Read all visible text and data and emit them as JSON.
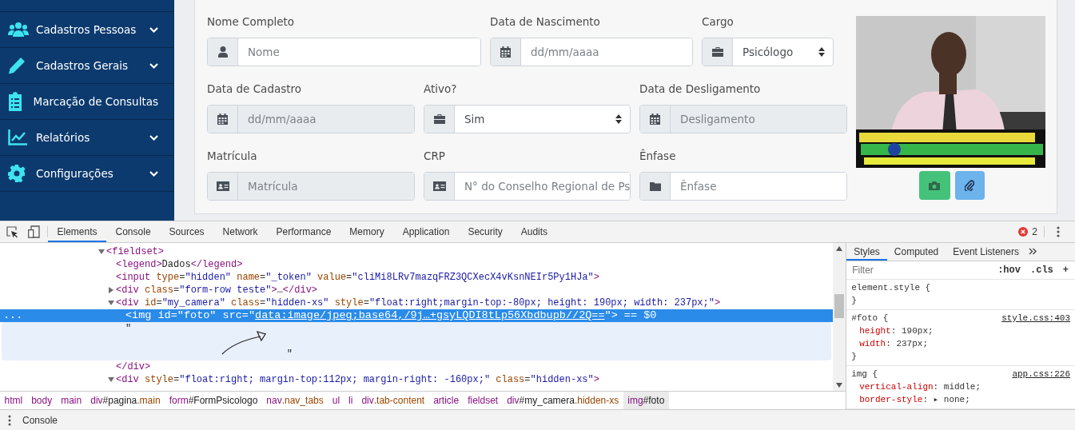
{
  "sidebar": {
    "items": [
      {
        "label": "Cadastros Pessoas",
        "expandable": true
      },
      {
        "label": "Cadastros Gerais",
        "expandable": true
      },
      {
        "label": "Marcação de Consultas",
        "expandable": false
      },
      {
        "label": "Relatórios",
        "expandable": true
      },
      {
        "label": "Configurações",
        "expandable": true
      }
    ]
  },
  "form": {
    "rows": [
      [
        {
          "label": "Nome Completo",
          "kind": "text",
          "placeholder": "Nome",
          "disabled": false
        },
        {
          "label": "Data de Nascimento",
          "kind": "text",
          "placeholder": "dd/mm/aaaa",
          "disabled": false
        },
        {
          "label": "Cargo",
          "kind": "select",
          "value": "Psicólogo",
          "disabled": false
        }
      ],
      [
        {
          "label": "Data de Cadastro",
          "kind": "text",
          "placeholder": "dd/mm/aaaa",
          "disabled": true
        },
        {
          "label": "Ativo?",
          "kind": "select",
          "value": "Sim",
          "disabled": false
        },
        {
          "label": "Data de Desligamento",
          "kind": "text",
          "placeholder": "Desligamento",
          "disabled": true
        }
      ],
      [
        {
          "label": "Matrícula",
          "kind": "text",
          "placeholder": "Matrícula",
          "disabled": true
        },
        {
          "label": "CRP",
          "kind": "text",
          "placeholder": "N° do Conselho Regional de Ps",
          "disabled": false
        },
        {
          "label": "Ênfase",
          "kind": "text",
          "placeholder": "Ênfase",
          "disabled": false
        }
      ]
    ]
  },
  "devtools": {
    "tabs": [
      {
        "label": "Elements",
        "selected": true
      },
      {
        "label": "Console",
        "selected": false
      },
      {
        "label": "Sources",
        "selected": false
      },
      {
        "label": "Network",
        "selected": false
      },
      {
        "label": "Performance",
        "selected": false
      },
      {
        "label": "Memory",
        "selected": false
      },
      {
        "label": "Application",
        "selected": false
      },
      {
        "label": "Security",
        "selected": false
      },
      {
        "label": "Audits",
        "selected": false
      }
    ],
    "error_count": "2",
    "dom_tree": [
      {
        "expanded": true,
        "selected": false,
        "tokens": [
          {
            "kind": "tag",
            "text": "<fieldset>"
          }
        ],
        "children": [
          {
            "selected": false,
            "tokens": [
              {
                "kind": "tag",
                "text": "<legend>"
              },
              {
                "kind": "text",
                "text": "Dados"
              },
              {
                "kind": "tag",
                "text": "</legend>"
              }
            ]
          },
          {
            "selected": false,
            "tokens": [
              {
                "kind": "tag",
                "text": "<input"
              },
              {
                "kind": "attr",
                "text": " type"
              },
              {
                "kind": "punct",
                "text": "="
              },
              {
                "kind": "value",
                "text": "\"hidden\""
              },
              {
                "kind": "attr",
                "text": " name"
              },
              {
                "kind": "punct",
                "text": "="
              },
              {
                "kind": "value",
                "text": "\"_token\""
              },
              {
                "kind": "attr",
                "text": " value"
              },
              {
                "kind": "punct",
                "text": "="
              },
              {
                "kind": "value",
                "text": "\"cliMi8LRv7mazqFRZ3QCXecX4vKsnNEIr5Py1HJa\""
              },
              {
                "kind": "tag",
                "text": ">"
              }
            ]
          },
          {
            "expanded": false,
            "selected": false,
            "tokens": [
              {
                "kind": "tag",
                "text": "<div"
              },
              {
                "kind": "attr",
                "text": " class"
              },
              {
                "kind": "punct",
                "text": "="
              },
              {
                "kind": "value",
                "text": "\"form-row teste\""
              },
              {
                "kind": "tag",
                "text": ">"
              },
              {
                "kind": "text",
                "text": "…"
              },
              {
                "kind": "tag",
                "text": "</div>"
              }
            ]
          },
          {
            "expanded": true,
            "selected": false,
            "tokens": [
              {
                "kind": "tag",
                "text": "<div"
              },
              {
                "kind": "attr",
                "text": " id"
              },
              {
                "kind": "punct",
                "text": "="
              },
              {
                "kind": "value",
                "text": "\"my_camera\""
              },
              {
                "kind": "attr",
                "text": " class"
              },
              {
                "kind": "punct",
                "text": "="
              },
              {
                "kind": "value",
                "text": "\"hidden-xs\""
              },
              {
                "kind": "attr",
                "text": " style"
              },
              {
                "kind": "punct",
                "text": "="
              },
              {
                "kind": "value",
                "text": "\"float:right;margin-top:-80px; height: 190px; width: 237px;\""
              },
              {
                "kind": "tag",
                "text": ">"
              }
            ],
            "children": [
              {
                "selected": true,
                "gutter": "...",
                "tokens": [
                  {
                    "kind": "tag",
                    "text": "<img"
                  },
                  {
                    "kind": "attr",
                    "text": " id"
                  },
                  {
                    "kind": "punct",
                    "text": "="
                  },
                  {
                    "kind": "value",
                    "text": "\"foto\""
                  },
                  {
                    "kind": "attr",
                    "text": " src"
                  },
                  {
                    "kind": "punct",
                    "text": "="
                  },
                  {
                    "kind": "value",
                    "text": "\""
                  },
                  {
                    "kind": "link",
                    "text": "data:image/jpeg;base64,/9j…+gsyLQDI8tLp56Xbdbupb//2Q=="
                  },
                  {
                    "kind": "value",
                    "text": "\""
                  },
                  {
                    "kind": "tag",
                    "text": ">"
                  },
                  {
                    "kind": "hint",
                    "text": " == $0"
                  }
                ]
              },
              {
                "selected": false,
                "hovered": true,
                "text_node": "\"\n\n                            \""
              }
            ],
            "closing": [
              {
                "kind": "tag",
                "text": "</div>"
              }
            ]
          },
          {
            "expanded": true,
            "selected": false,
            "tokens": [
              {
                "kind": "tag",
                "text": "<div"
              },
              {
                "kind": "attr",
                "text": " style"
              },
              {
                "kind": "punct",
                "text": "="
              },
              {
                "kind": "value",
                "text": "\"float:right; margin-top:112px; margin-right: -160px;\""
              },
              {
                "kind": "attr",
                "text": " class"
              },
              {
                "kind": "punct",
                "text": "="
              },
              {
                "kind": "value",
                "text": "\"hidden-xs\""
              },
              {
                "kind": "tag",
                "text": ">"
              }
            ]
          }
        ]
      }
    ],
    "breadcrumbs": [
      {
        "selected": false,
        "tokens": [
          {
            "kind": "tag",
            "text": "html"
          }
        ]
      },
      {
        "selected": false,
        "tokens": [
          {
            "kind": "tag",
            "text": "body"
          }
        ]
      },
      {
        "selected": false,
        "tokens": [
          {
            "kind": "tag",
            "text": "main"
          }
        ]
      },
      {
        "selected": false,
        "tokens": [
          {
            "kind": "tag",
            "text": "div"
          },
          {
            "kind": "id",
            "text": "#pagina"
          },
          {
            "kind": "class",
            "text": ".main"
          }
        ]
      },
      {
        "selected": false,
        "tokens": [
          {
            "kind": "tag",
            "text": "form"
          },
          {
            "kind": "id",
            "text": "#FormPsicologo"
          }
        ]
      },
      {
        "selected": false,
        "tokens": [
          {
            "kind": "tag",
            "text": "nav"
          },
          {
            "kind": "class",
            "text": ".nav_tabs"
          }
        ]
      },
      {
        "selected": false,
        "tokens": [
          {
            "kind": "tag",
            "text": "ul"
          }
        ]
      },
      {
        "selected": false,
        "tokens": [
          {
            "kind": "tag",
            "text": "li"
          }
        ]
      },
      {
        "selected": false,
        "tokens": [
          {
            "kind": "tag",
            "text": "div"
          },
          {
            "kind": "class",
            "text": ".tab-content"
          }
        ]
      },
      {
        "selected": false,
        "tokens": [
          {
            "kind": "tag",
            "text": "article"
          }
        ]
      },
      {
        "selected": false,
        "tokens": [
          {
            "kind": "tag",
            "text": "fieldset"
          }
        ]
      },
      {
        "selected": false,
        "tokens": [
          {
            "kind": "tag",
            "text": "div"
          },
          {
            "kind": "id",
            "text": "#my_camera"
          },
          {
            "kind": "class",
            "text": ".hidden-xs"
          }
        ]
      },
      {
        "selected": true,
        "tokens": [
          {
            "kind": "tag",
            "text": "img"
          },
          {
            "kind": "id",
            "text": "#foto"
          }
        ]
      }
    ],
    "styles_pane": {
      "tabs": [
        {
          "label": "Styles",
          "selected": true
        },
        {
          "label": "Computed",
          "selected": false
        },
        {
          "label": "Event Listeners",
          "selected": false
        }
      ],
      "filter_placeholder": "Filter",
      "buttons": [
        ":hov",
        ".cls",
        "+"
      ],
      "rules": [
        {
          "selector": "element.style",
          "open_brace": " {",
          "close_brace": "}"
        },
        {
          "selector": "#foto",
          "open_brace": " {",
          "source": "style.css:403",
          "close_brace": "}",
          "declarations": [
            {
              "property": "height",
              "value": ": 190px;"
            },
            {
              "property": "width",
              "value": ": 237px;"
            }
          ]
        },
        {
          "selector": "img",
          "open_brace": " {",
          "source": "app.css:226",
          "declarations": [
            {
              "property": "vertical-align",
              "value": ": middle;"
            },
            {
              "property": "border-style",
              "value": ": ▸ none;"
            }
          ]
        }
      ]
    },
    "drawer": {
      "title": "Console"
    }
  }
}
